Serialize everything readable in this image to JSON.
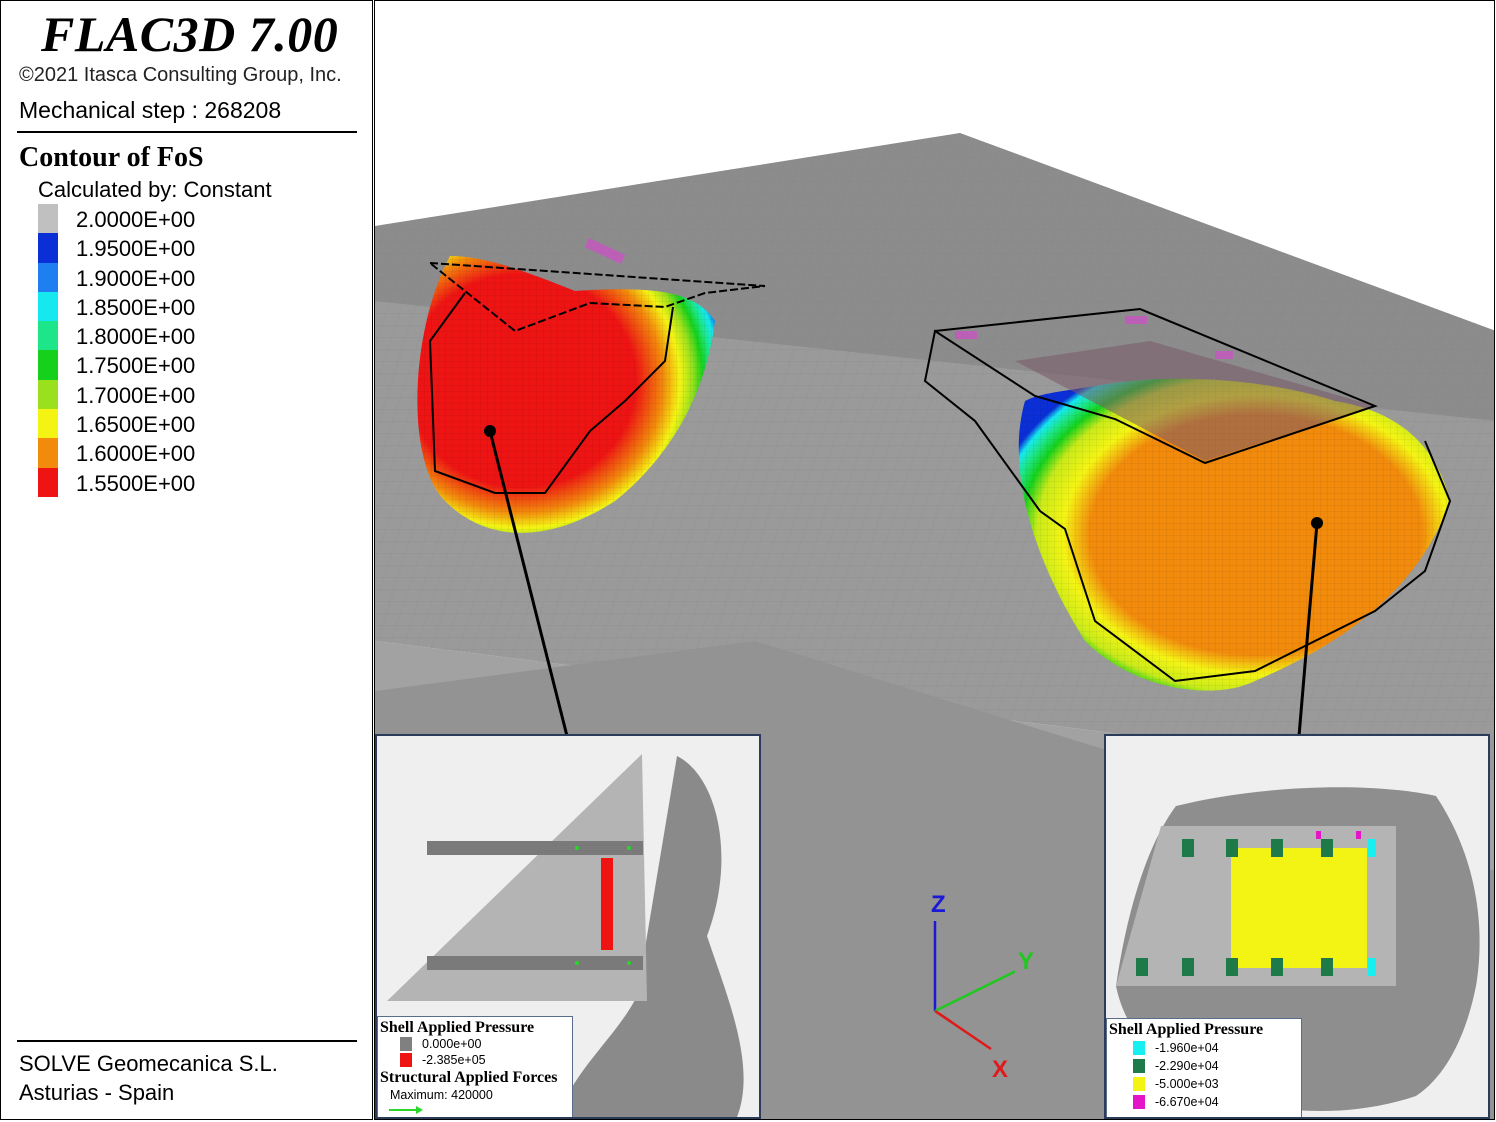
{
  "header": {
    "app_title": "FLAC3D 7.00",
    "copyright": "©2021 Itasca Consulting Group, Inc.",
    "step_label": "Mechanical step : 268208"
  },
  "contour": {
    "title": "Contour of FoS",
    "calculated_by": "Calculated by: Constant",
    "items": [
      {
        "label": "2.0000E+00",
        "color": "#c0c0c0"
      },
      {
        "label": "1.9500E+00",
        "color": "#0a2fd6"
      },
      {
        "label": "1.9000E+00",
        "color": "#1f7ff0"
      },
      {
        "label": "1.8500E+00",
        "color": "#16e8f0"
      },
      {
        "label": "1.8000E+00",
        "color": "#1de68a"
      },
      {
        "label": "1.7500E+00",
        "color": "#16d11c"
      },
      {
        "label": "1.7000E+00",
        "color": "#9be01d"
      },
      {
        "label": "1.6500E+00",
        "color": "#f4f414"
      },
      {
        "label": "1.6000E+00",
        "color": "#f28a0c"
      },
      {
        "label": "1.5500E+00",
        "color": "#ee1414"
      }
    ]
  },
  "footer": {
    "company": "SOLVE Geomecanica S.L.",
    "location": "Asturias - Spain"
  },
  "inset_left": {
    "pressure_title": "Shell Applied Pressure",
    "pressure_items": [
      {
        "label": "0.000e+00",
        "color": "#808080"
      },
      {
        "label": "-2.385e+05",
        "color": "#ee1414"
      }
    ],
    "forces_title": "Structural Applied Forces",
    "forces_max": "Maximum: 420000",
    "arrow_color": "#2ad62a"
  },
  "inset_right": {
    "pressure_title": "Shell Applied Pressure",
    "pressure_items": [
      {
        "label": "-1.960e+04",
        "color": "#16f0f0"
      },
      {
        "label": "-2.290e+04",
        "color": "#1f7a4a"
      },
      {
        "label": "-5.000e+03",
        "color": "#f4f414"
      },
      {
        "label": "-6.670e+04",
        "color": "#e414c8"
      }
    ]
  },
  "axes": {
    "z_label": "Z",
    "y_label": "Y",
    "x_label": "X",
    "z_color": "#1a1ad6",
    "y_color": "#1ec81e",
    "x_color": "#e01a1a"
  }
}
